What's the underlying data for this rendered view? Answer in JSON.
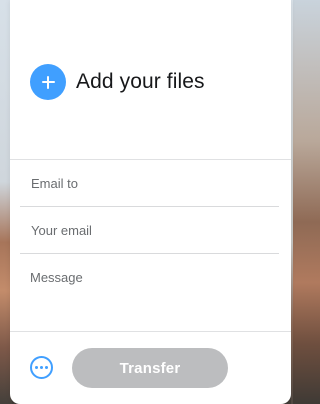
{
  "upload": {
    "add_files_label": "Add your files",
    "add_icon": "plus-icon"
  },
  "form": {
    "email_to_placeholder": "Email to",
    "your_email_placeholder": "Your email",
    "message_placeholder": "Message"
  },
  "actions": {
    "more_icon": "more-options-icon",
    "transfer_label": "Transfer",
    "transfer_enabled": false
  },
  "colors": {
    "accent": "#409fff",
    "disabled_button": "#bcbdbf",
    "panel_background": "#ffffff"
  }
}
